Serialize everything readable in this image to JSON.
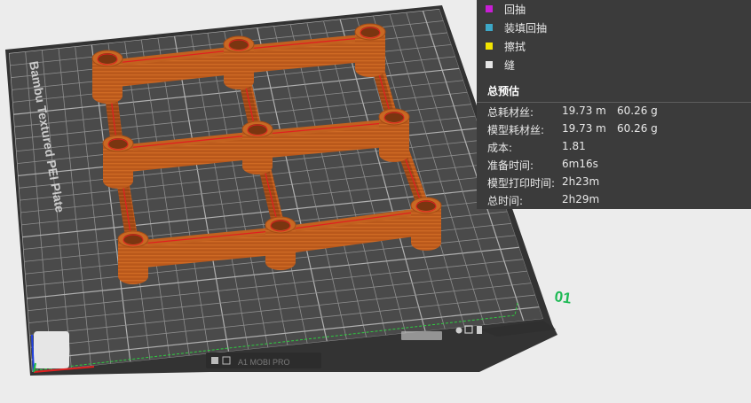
{
  "plate": {
    "label": "Bambu Textured PEI Plate",
    "number": "01",
    "bottom_text": "A1 MOBI PRO"
  },
  "legend": {
    "items": [
      {
        "label": "回抽",
        "color": "#c81ed6"
      },
      {
        "label": "装填回抽",
        "color": "#3da8c8"
      },
      {
        "label": "擦拭",
        "color": "#f2e400"
      },
      {
        "label": "缝",
        "color": "#e6e6e6"
      }
    ]
  },
  "summary": {
    "title": "总预估",
    "rows": [
      {
        "label": "总耗材丝:",
        "value1": "19.73 m",
        "value2": "60.26 g"
      },
      {
        "label": "模型耗材丝:",
        "value1": "19.73 m",
        "value2": "60.26 g"
      },
      {
        "label": "成本:",
        "value1": "1.81",
        "value2": ""
      },
      {
        "label": "准备时间:",
        "value1": "6m16s",
        "value2": ""
      },
      {
        "label": "模型打印时间:",
        "value1": "2h23m",
        "value2": ""
      },
      {
        "label": "总时间:",
        "value1": "2h29m",
        "value2": ""
      }
    ]
  },
  "colors": {
    "plate": "#444444",
    "grid": "#8a8a8a",
    "model": "#b85a1e",
    "model_dark": "#8a3e12",
    "seam": "#e02020",
    "accent_green": "#1db954"
  }
}
